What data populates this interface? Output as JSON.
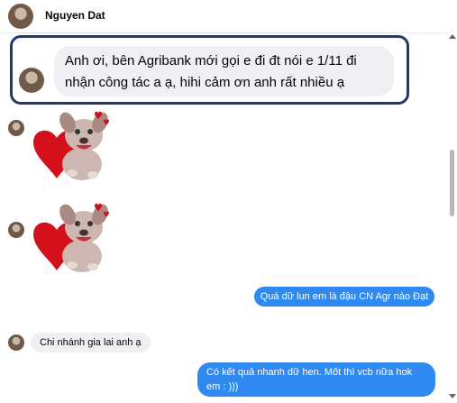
{
  "header": {
    "contact_name": "Nguyen Dat"
  },
  "messages": {
    "highlighted_incoming": "Anh ơi, bên Agribank mới gọi e đi đt nói e 1/11 đi nhận công tác a ạ, hihi cảm ơn anh rất nhiều ạ",
    "outgoing_1": "Quá dữ lun em là đậu CN Agr nào Đạt",
    "incoming_2": "Chi nhánh gia lai anh ạ",
    "outgoing_2": "Có kết quả nhanh dữ hen. Mốt thì vcb nữa hok em : )))"
  },
  "colors": {
    "outgoing_bubble": "#2e89f0",
    "incoming_bubble": "#eef0f3",
    "highlight_border": "#20396d"
  },
  "icons": {
    "sticker": "dog-heart-sticker"
  }
}
